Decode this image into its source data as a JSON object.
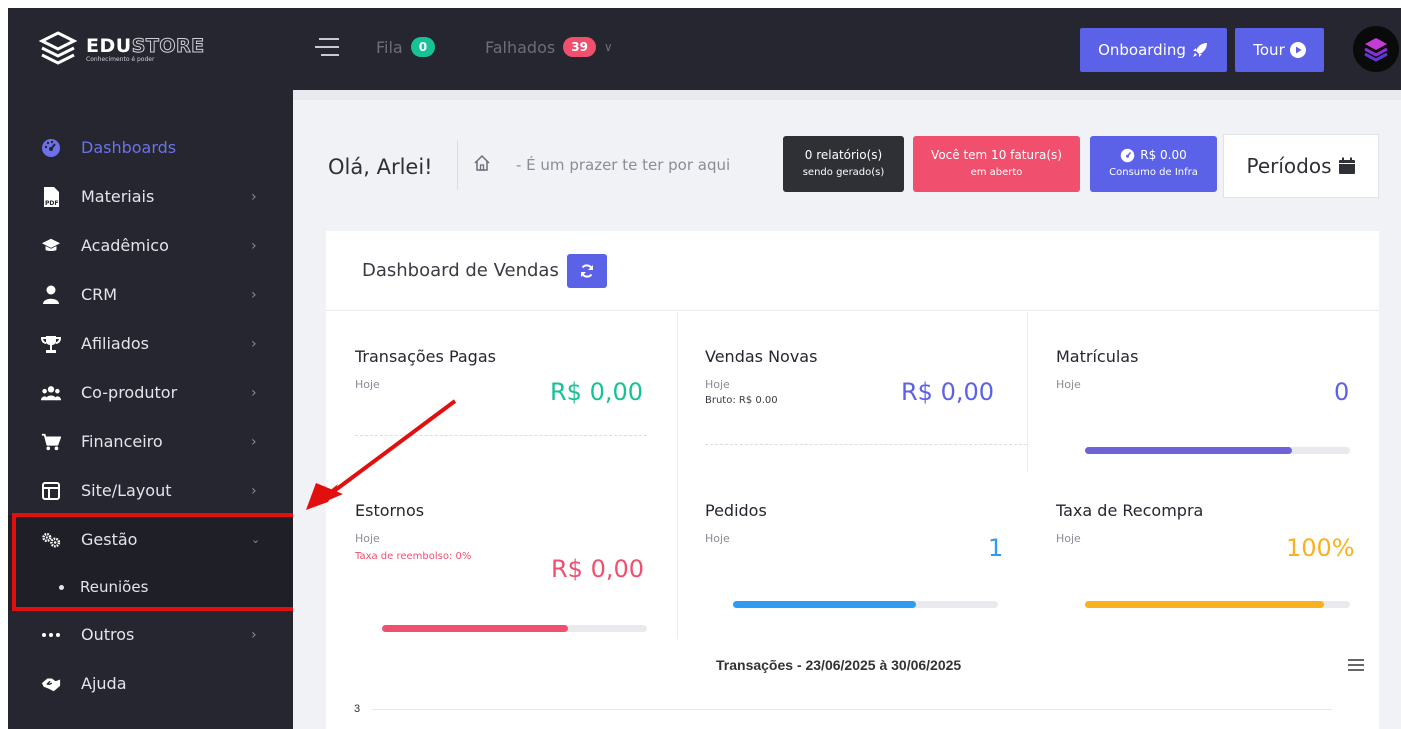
{
  "brand": {
    "name_a": "EDU",
    "name_b": "STORE",
    "tagline": "Conhecimento é poder"
  },
  "topbar": {
    "fila_label": "Fila",
    "fila_count": "0",
    "falhados_label": "Falhados",
    "falhados_count": "39",
    "onboarding_label": "Onboarding",
    "tour_label": "Tour"
  },
  "sidebar": {
    "items": [
      {
        "label": "Dashboards",
        "icon": "dashboard-icon"
      },
      {
        "label": "Materiais",
        "icon": "pdf-icon"
      },
      {
        "label": "Acadêmico",
        "icon": "graduation-cap-icon"
      },
      {
        "label": "CRM",
        "icon": "user-icon"
      },
      {
        "label": "Afiliados",
        "icon": "trophy-icon"
      },
      {
        "label": "Co-produtor",
        "icon": "users-icon"
      },
      {
        "label": "Financeiro",
        "icon": "cart-icon"
      },
      {
        "label": "Site/Layout",
        "icon": "layout-icon"
      },
      {
        "label": "Gestão",
        "icon": "cogs-icon"
      },
      {
        "label": "Outros",
        "icon": "dots-icon"
      },
      {
        "label": "Ajuda",
        "icon": "handshake-icon"
      }
    ],
    "submenu": {
      "label": "Reuniões"
    }
  },
  "header": {
    "greeting": "Olá, Arlei!",
    "welcome": "- É um prazer te ter por aqui",
    "reports_line1": "0 relatório(s)",
    "reports_line2": "sendo gerado(s)",
    "invoices_line1": "Você tem 10 fatura(s)",
    "invoices_line2": "em aberto",
    "infra_line1": "R$ 0.00",
    "infra_line2": "Consumo de Infra",
    "periodos": "Períodos"
  },
  "dashboard": {
    "title": "Dashboard de Vendas",
    "stats": {
      "transacoes": {
        "title": "Transações Pagas",
        "sub": "Hoje",
        "value": "R$ 0,00"
      },
      "vendas": {
        "title": "Vendas Novas",
        "sub": "Hoje",
        "sub2": "Bruto: R$ 0.00",
        "value": "R$ 0,00"
      },
      "matriculas": {
        "title": "Matrículas",
        "sub": "Hoje",
        "value": "0",
        "progress": 0.78
      },
      "estornos": {
        "title": "Estornos",
        "sub": "Hoje",
        "note": "Taxa de reembolso: 0%",
        "value": "R$ 0,00",
        "progress": 0.7
      },
      "pedidos": {
        "title": "Pedidos",
        "sub": "Hoje",
        "value": "1",
        "progress": 0.69
      },
      "recompra": {
        "title": "Taxa de Recompra",
        "sub": "Hoje",
        "value": "100%",
        "progress": 0.9
      }
    },
    "chart": {
      "title": "Transações - 23/06/2025 à 30/06/2025",
      "ytick": "3"
    }
  },
  "colors": {
    "accent": "#5b62e8",
    "green": "#16c296",
    "red": "#f0506e",
    "blue": "#2f9cf3",
    "purple": "#6d63d6",
    "orange": "#f9b21e",
    "dark": "#25262f",
    "highlight": "#e20f0f"
  }
}
